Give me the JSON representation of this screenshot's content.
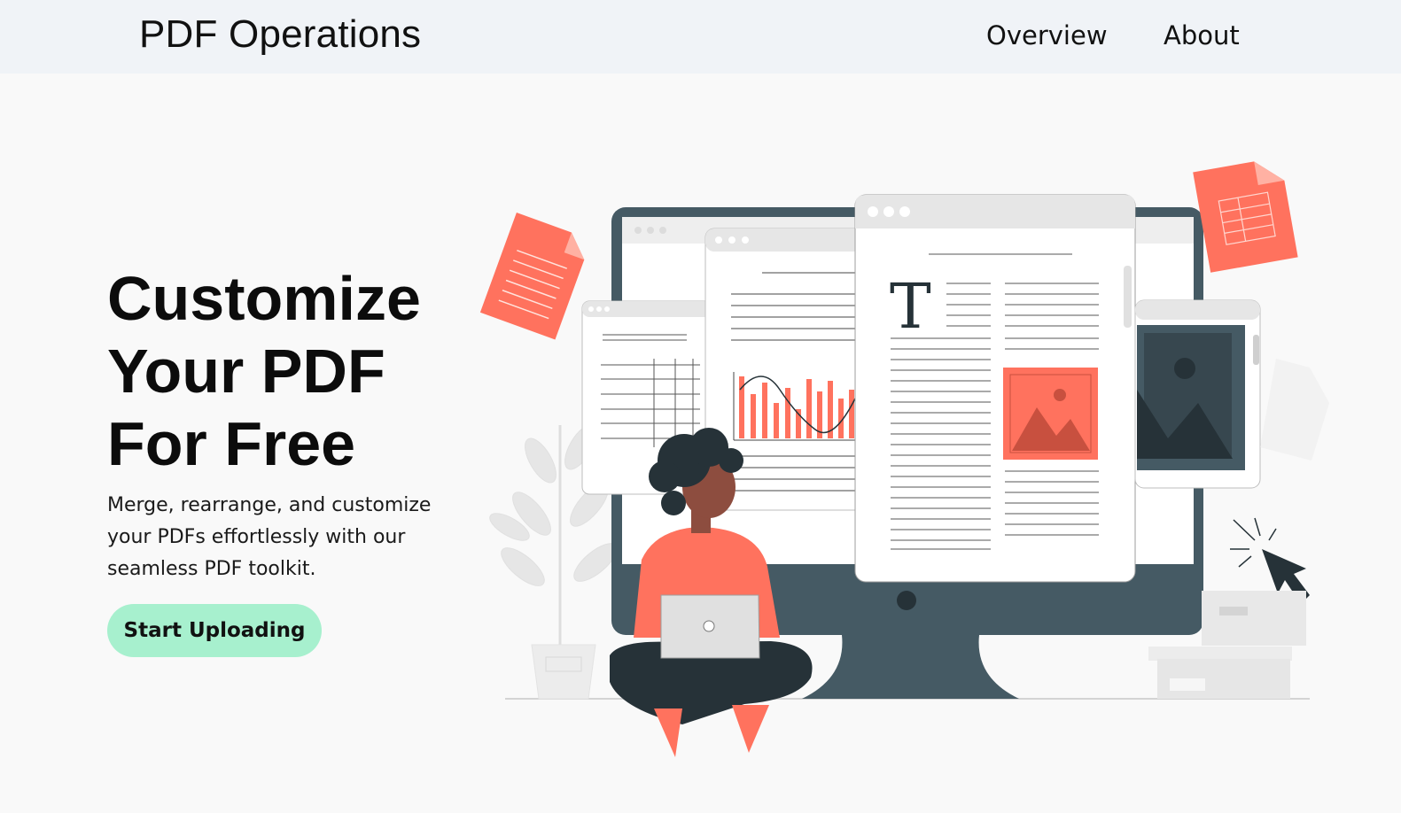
{
  "nav": {
    "brand": "PDF Operations",
    "links": [
      {
        "label": "Overview"
      },
      {
        "label": "About"
      }
    ]
  },
  "hero": {
    "title_lines": [
      "Customize",
      "Your PDF",
      "For Free"
    ],
    "subtitle": "Merge, rearrange, and customize your PDFs effortlessly with our seamless PDF toolkit.",
    "cta_label": "Start Uploading"
  },
  "illustration": {
    "text_glyph": "T",
    "icons": [
      "pdf-file-icon",
      "spreadsheet-file-icon",
      "image-icon",
      "cursor-icon"
    ],
    "colors": {
      "accent": "#ff725e",
      "dark": "#455a64",
      "button": "#a7f0ce",
      "nav_bg": "#f0f3f7"
    }
  }
}
